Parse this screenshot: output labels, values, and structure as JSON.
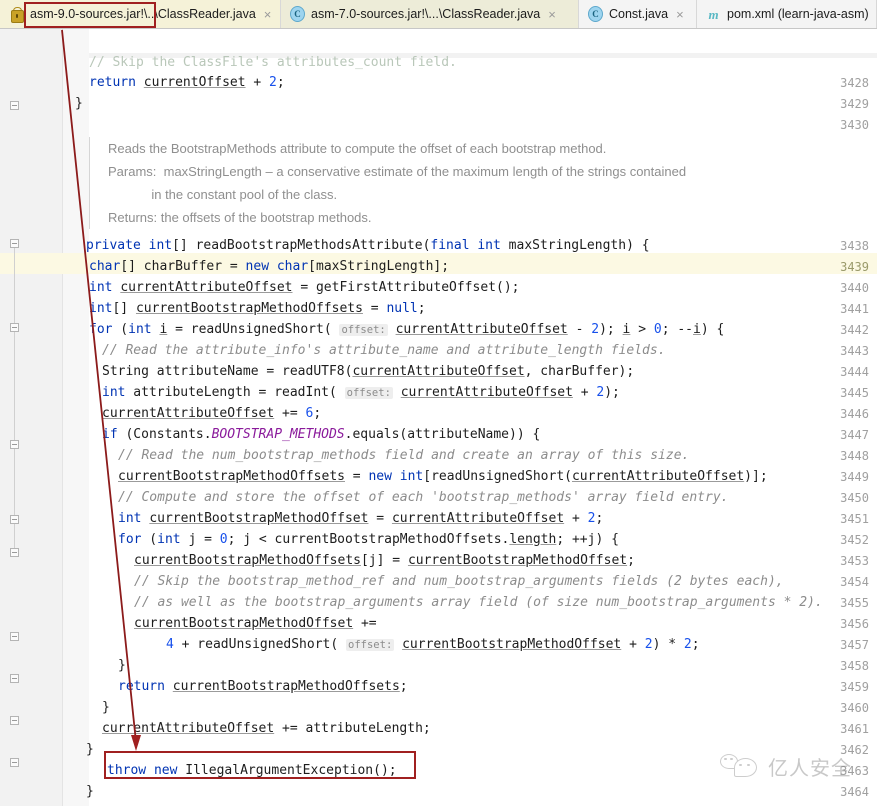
{
  "window": {
    "app": "IntelliJ IDEA Editor",
    "file_title": "ClassReader.java"
  },
  "tabs": [
    {
      "icon": "jar-lock-icon",
      "label": "asm-9.0-sources.jar!\\..\\ClassReader.java",
      "close": "×",
      "state": "active"
    },
    {
      "icon": "java-class-icon",
      "label": "asm-7.0-sources.jar!\\...\\ClassReader.java",
      "close": "×",
      "state": "inactive"
    },
    {
      "icon": "java-class-icon",
      "label": "Const.java",
      "close": "×",
      "state": "plain"
    },
    {
      "icon": "maven-icon",
      "label": "pom.xml (learn-java-asm)",
      "close": "×",
      "state": "plain"
    }
  ],
  "editor": {
    "partial_top_comment": "// Skip the ClassFile's attributes_count field.",
    "doc_popup": [
      "Reads the BootstrapMethods attribute to compute the offset of each bootstrap method.",
      "Params:  maxStringLength – a conservative estimate of the maximum length of the strings contained",
      "            in the constant pool of the class.",
      "Returns: the offsets of the bootstrap methods."
    ],
    "line_numbers": [
      "3428",
      "3429",
      "3430",
      "3438",
      "3439",
      "3440",
      "3441",
      "3442",
      "3443",
      "3444",
      "3445",
      "3446",
      "3447",
      "3448",
      "3449",
      "3450",
      "3451",
      "3452",
      "3453",
      "3454",
      "3455",
      "3456",
      "3457",
      "3458",
      "3459",
      "3460",
      "3461",
      "3462",
      "3463",
      "3464"
    ],
    "highlighted_line": "3439",
    "lines": [
      {
        "n": "3428",
        "text": "  return currentOffset + 2;"
      },
      {
        "n": "3429",
        "text": "}"
      },
      {
        "n": "3430",
        "text": ""
      },
      {
        "n": "3438",
        "text": "private int[] readBootstrapMethodsAttribute(final int maxStringLength) {"
      },
      {
        "n": "3439",
        "text": "  char[] charBuffer = new char[maxStringLength];"
      },
      {
        "n": "3440",
        "text": "  int currentAttributeOffset = getFirstAttributeOffset();"
      },
      {
        "n": "3441",
        "text": "  int[] currentBootstrapMethodOffsets = null;"
      },
      {
        "n": "3442",
        "text": "  for (int i = readUnsignedShort( offset: currentAttributeOffset - 2); i > 0; --i) {"
      },
      {
        "n": "3443",
        "text": "    // Read the attribute_info's attribute_name and attribute_length fields."
      },
      {
        "n": "3444",
        "text": "    String attributeName = readUTF8(currentAttributeOffset, charBuffer);"
      },
      {
        "n": "3445",
        "text": "    int attributeLength = readInt( offset: currentAttributeOffset + 2);"
      },
      {
        "n": "3446",
        "text": "    currentAttributeOffset += 6;"
      },
      {
        "n": "3447",
        "text": "    if (Constants.BOOTSTRAP_METHODS.equals(attributeName)) {"
      },
      {
        "n": "3448",
        "text": "      // Read the num_bootstrap_methods field and create an array of this size."
      },
      {
        "n": "3449",
        "text": "      currentBootstrapMethodOffsets = new int[readUnsignedShort(currentAttributeOffset)];"
      },
      {
        "n": "3450",
        "text": "      // Compute and store the offset of each 'bootstrap_methods' array field entry."
      },
      {
        "n": "3451",
        "text": "      int currentBootstrapMethodOffset = currentAttributeOffset + 2;"
      },
      {
        "n": "3452",
        "text": "      for (int j = 0; j < currentBootstrapMethodOffsets.length; ++j) {"
      },
      {
        "n": "3453",
        "text": "        currentBootstrapMethodOffsets[j] = currentBootstrapMethodOffset;"
      },
      {
        "n": "3454",
        "text": "        // Skip the bootstrap_method_ref and num_bootstrap_arguments fields (2 bytes each),"
      },
      {
        "n": "3455",
        "text": "        // as well as the bootstrap_arguments array field (of size num_bootstrap_arguments * 2)."
      },
      {
        "n": "3456",
        "text": "        currentBootstrapMethodOffset +="
      },
      {
        "n": "3457",
        "text": "            4 + readUnsignedShort( offset: currentBootstrapMethodOffset + 2) * 2;"
      },
      {
        "n": "3458",
        "text": "      }"
      },
      {
        "n": "3459",
        "text": "      return currentBootstrapMethodOffsets;"
      },
      {
        "n": "3460",
        "text": "    }"
      },
      {
        "n": "3461",
        "text": "    currentAttributeOffset += attributeLength;"
      },
      {
        "n": "3462",
        "text": "  }"
      },
      {
        "n": "3463",
        "text": "  throw new IllegalArgumentException();"
      },
      {
        "n": "3464",
        "text": "}"
      }
    ],
    "parameter_hint": "offset:"
  },
  "annotations": {
    "tab_highlight_target": "asm-9.0-sources.jar!\\..\\ClassReader.java",
    "throw_highlight_target": "throw new IllegalArgumentException();",
    "arrow_color": "#a02020",
    "box_color": "#a02020"
  },
  "watermark": {
    "text": "亿人安全"
  },
  "colors": {
    "keyword": "#0033b3",
    "number": "#1750eb",
    "comment": "#8c8c8c",
    "static_field": "#8a1a9b",
    "tab_active_bg": "#f5f2d8",
    "line_highlight": "#fcf9e3",
    "gutter_bg": "#f2f2f2"
  }
}
